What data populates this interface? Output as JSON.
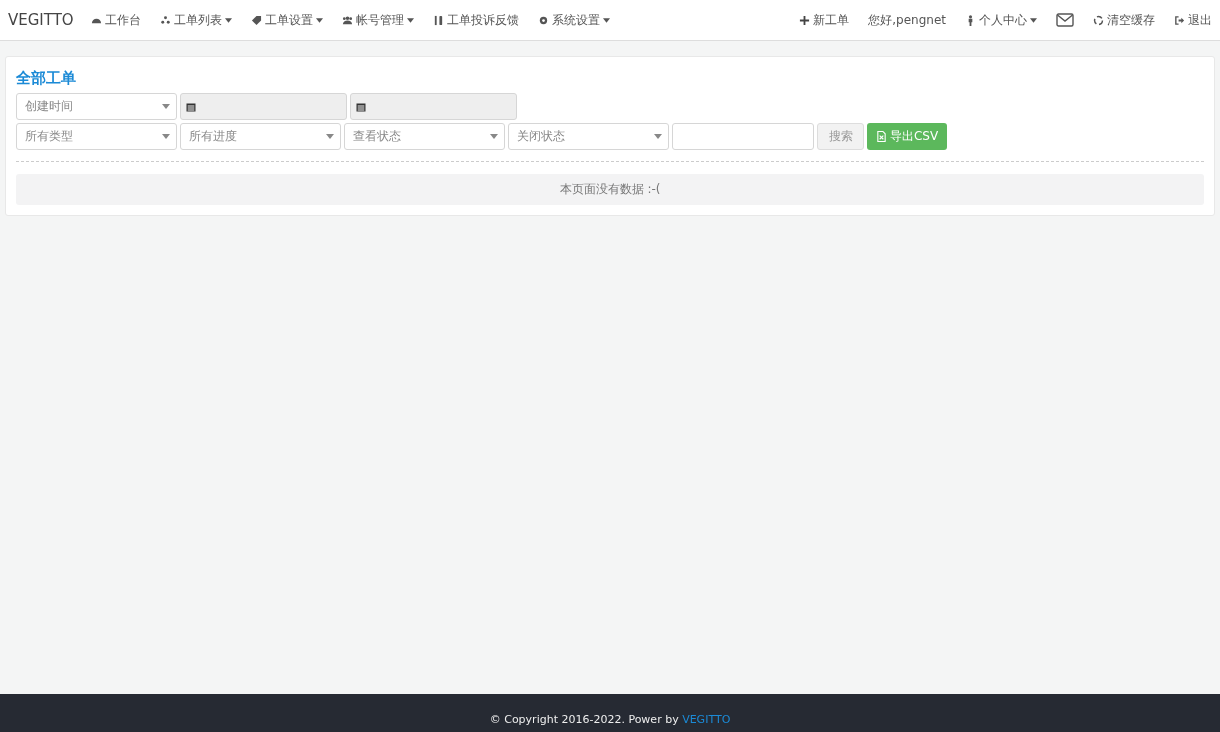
{
  "navbar": {
    "brand": "VEGITTO",
    "left_items": [
      {
        "label": "工作台",
        "dropdown": false
      },
      {
        "label": "工单列表",
        "dropdown": true
      },
      {
        "label": "工单设置",
        "dropdown": true
      },
      {
        "label": "帐号管理",
        "dropdown": true
      },
      {
        "label": "工单投诉反馈",
        "dropdown": false
      },
      {
        "label": "系统设置",
        "dropdown": true
      }
    ],
    "new_ticket": "新工单",
    "greeting": "您好,pengnet",
    "profile": {
      "label": "个人中心",
      "dropdown": true
    },
    "clear_cache": "清空缓存",
    "logout": "退出"
  },
  "panel": {
    "title": "全部工单",
    "time_select": "创建时间",
    "filters": [
      "所有类型",
      "所有进度",
      "查看状态",
      "关闭状态"
    ],
    "search_button": "搜索",
    "export_button": "导出CSV",
    "empty_message": "本页面没有数据 :-("
  },
  "footer": {
    "text": "© Copyright 2016-2022. Power by",
    "link": "VEGITTO"
  }
}
